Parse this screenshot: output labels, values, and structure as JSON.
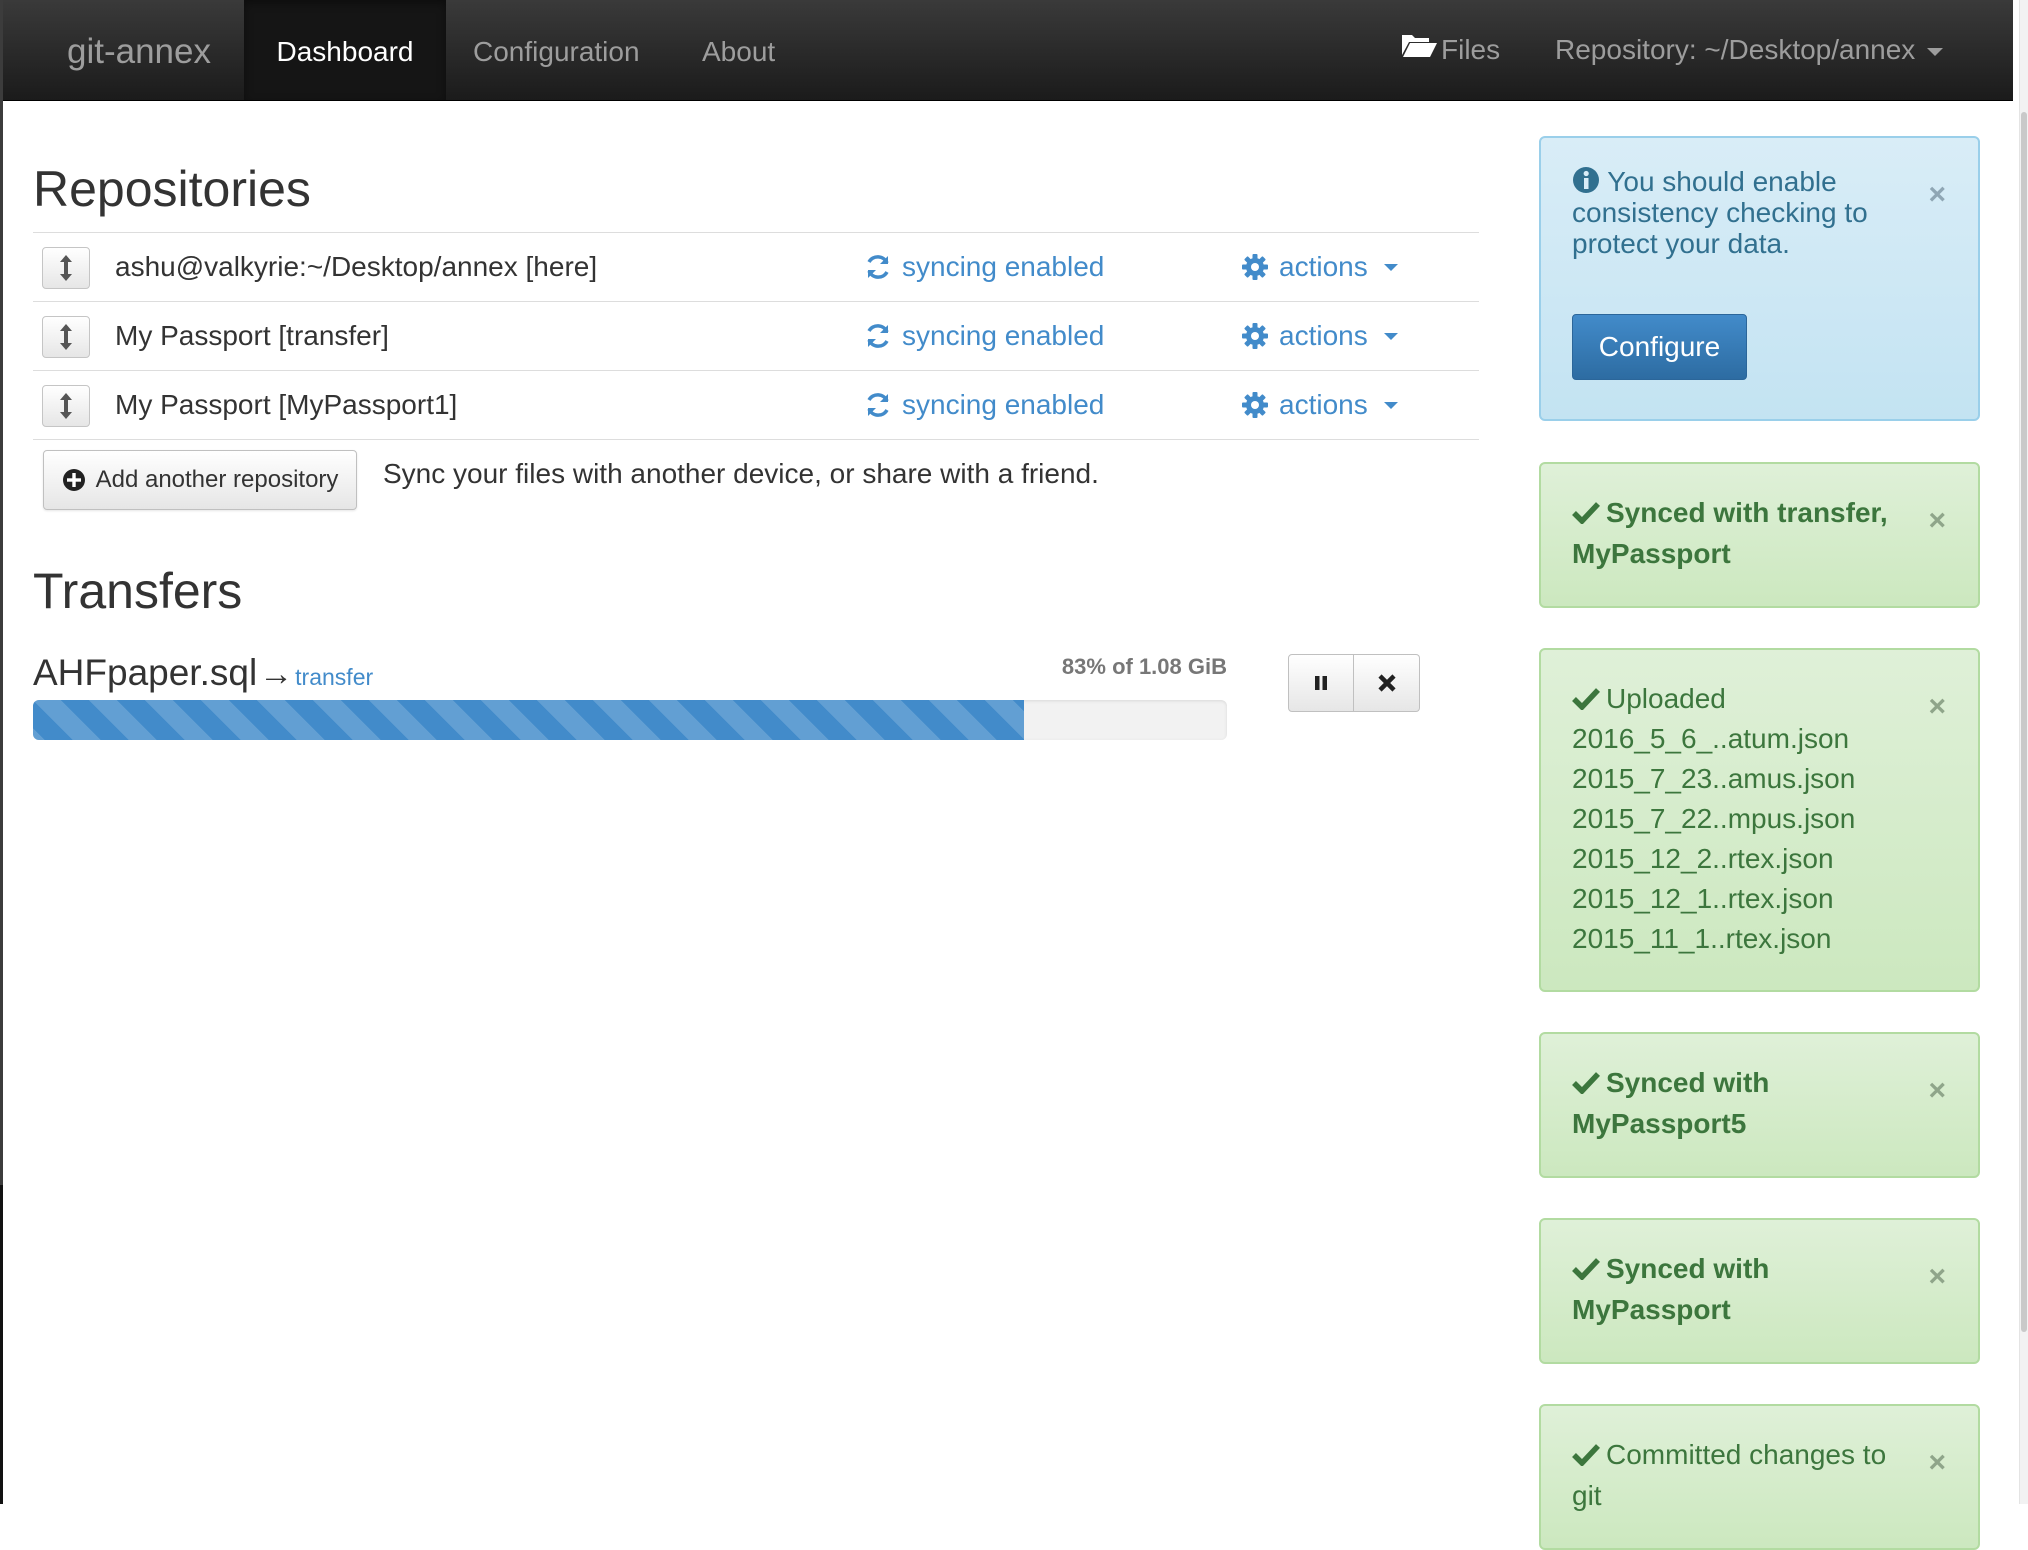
{
  "navbar": {
    "brand": "git-annex",
    "tabs": [
      {
        "label": "Dashboard",
        "active": true
      },
      {
        "label": "Configuration",
        "active": false
      },
      {
        "label": "About",
        "active": false
      }
    ],
    "files_label": "Files",
    "files_icon": "folder-open-icon",
    "repository_label": "Repository: ~/Desktop/annex"
  },
  "repositories": {
    "heading": "Repositories",
    "rows": [
      {
        "name": "ashu@valkyrie:~/Desktop/annex [here]",
        "sync": "syncing enabled",
        "actions": "actions"
      },
      {
        "name": "My Passport [transfer]",
        "sync": "syncing enabled",
        "actions": "actions"
      },
      {
        "name": "My Passport [MyPassport1]",
        "sync": "syncing enabled",
        "actions": "actions"
      }
    ],
    "add_button": "Add another repository",
    "add_description": "Sync your files with another device, or share with a friend."
  },
  "transfers": {
    "heading": "Transfers",
    "items": [
      {
        "file": "AHFpaper.sql",
        "arrow": "→",
        "destination": "transfer",
        "status": "83% of 1.08 GiB",
        "progress_fraction": 0.83
      }
    ]
  },
  "alerts": [
    {
      "type": "info",
      "message": "You should enable consistency checking to protect your data.",
      "button": "Configure"
    },
    {
      "type": "success",
      "title": "Synced with transfer, MyPassport"
    },
    {
      "type": "success",
      "title": "Uploaded",
      "files": [
        "2016_5_6_..atum.json",
        "2015_7_23..amus.json",
        "2015_7_22..mpus.json",
        "2015_12_2..rtex.json",
        "2015_12_1..rtex.json",
        "2015_11_1..rtex.json"
      ]
    },
    {
      "type": "success",
      "title": "Synced with MyPassport5"
    },
    {
      "type": "success",
      "title": "Synced with MyPassport"
    },
    {
      "type": "success",
      "title": "Committed changes to git"
    }
  ],
  "colors": {
    "navbar": "#222222",
    "link": "#428bca",
    "info_bg": "#d9edf7",
    "success_bg": "#dff0d8",
    "progress": "#428bca"
  }
}
